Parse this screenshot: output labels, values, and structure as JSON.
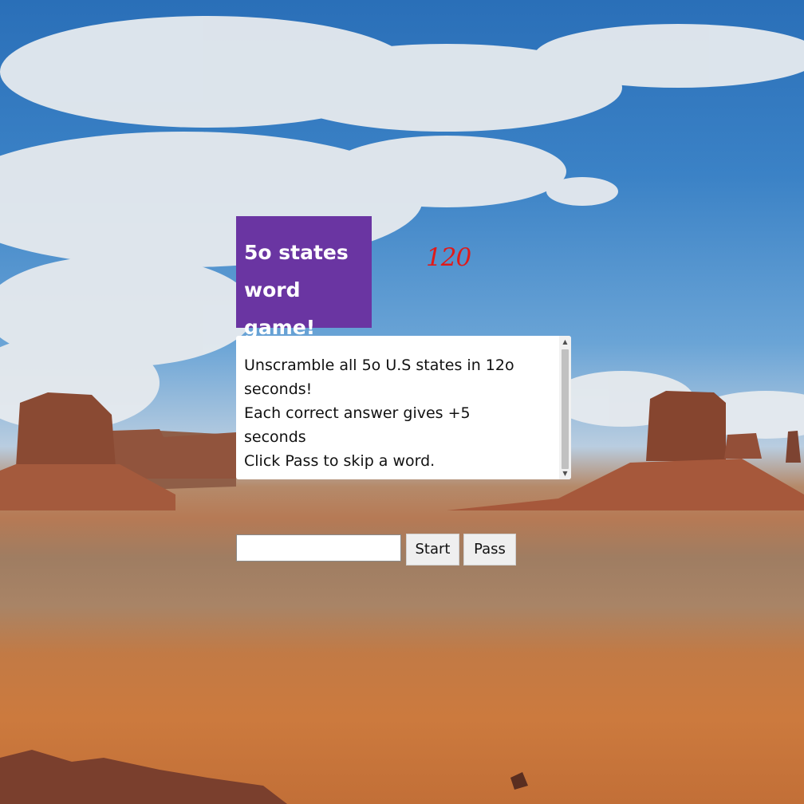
{
  "game": {
    "title_line1": "5o states",
    "title_line2": "word game!",
    "timer": "120",
    "instructions": [
      "Unscramble all 5o U.S states in 12o",
      "seconds!",
      "Each correct answer gives +5",
      "seconds",
      "Click Pass to skip a word."
    ],
    "answer": {
      "value": "",
      "placeholder": ""
    },
    "start_label": "Start",
    "pass_label": "Pass"
  },
  "colors": {
    "title_bg": "#6a35a2",
    "timer": "#e01a1a",
    "panel_bg": "#ffffff"
  }
}
